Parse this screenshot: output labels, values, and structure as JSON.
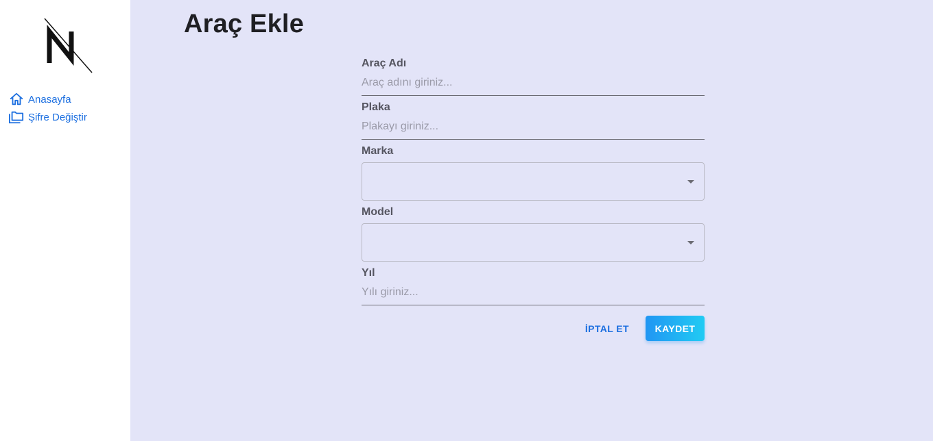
{
  "sidebar": {
    "logo_icon": "n-slash-logo-icon",
    "items": [
      {
        "label": "Anasayfa",
        "icon": "home-icon"
      },
      {
        "label": "Şifre Değiştir",
        "icon": "folders-icon"
      }
    ]
  },
  "main": {
    "title": "Araç Ekle",
    "form": {
      "name": {
        "label": "Araç Adı",
        "placeholder": "Araç adını giriniz...",
        "value": ""
      },
      "plate": {
        "label": "Plaka",
        "placeholder": "Plakayı giriniz...",
        "value": ""
      },
      "brand": {
        "label": "Marka",
        "value": ""
      },
      "model": {
        "label": "Model",
        "value": ""
      },
      "year": {
        "label": "Yıl",
        "placeholder": "Yılı giriniz...",
        "value": ""
      }
    },
    "actions": {
      "cancel_label": "İPTAL ET",
      "save_label": "KAYDET"
    }
  },
  "colors": {
    "accent": "#1c6fe0",
    "background": "#e3e4f8",
    "save_gradient_start": "#2196f3",
    "save_gradient_end": "#21cbf3"
  }
}
